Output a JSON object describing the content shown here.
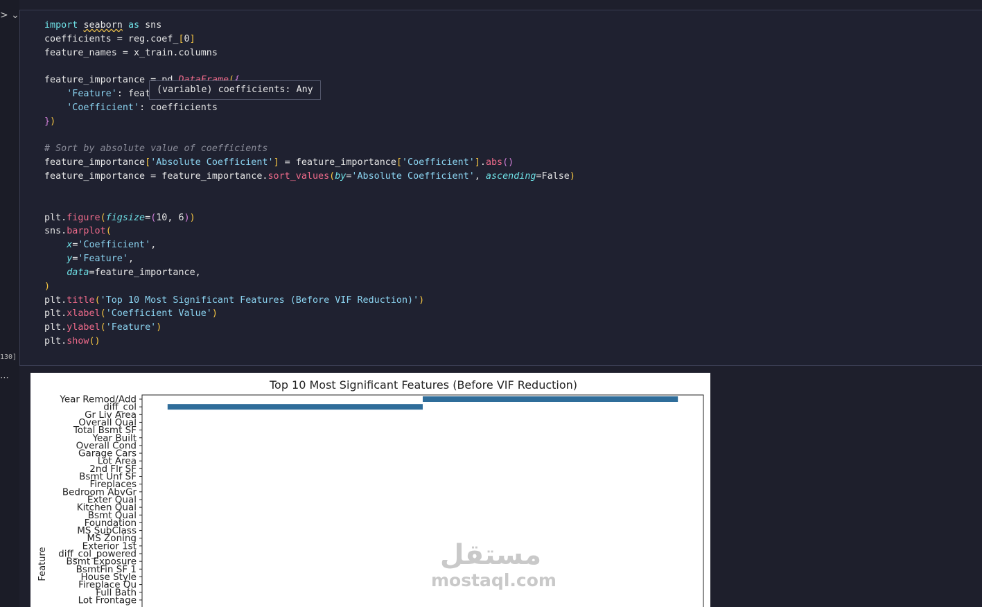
{
  "execution_count": "130]",
  "tooltip": "(variable) coefficients: Any",
  "code": {
    "import_kw": "import",
    "module": "seaborn",
    "as_kw": "as",
    "alias": "sns",
    "feature_label": "'Feature'",
    "feat_partial": "feat",
    "comment": "# Sort by absolute value of coefficients"
  },
  "output": {
    "title": "Top 10 Most Significant Features (Before VIF Reduction)",
    "ylabel": "Feature",
    "watermark_arabic": "مستقل",
    "watermark_latin": "mostaql.com"
  },
  "chart_data": {
    "type": "bar",
    "orientation": "horizontal",
    "title": "Top 10 Most Significant Features (Before VIF Reduction)",
    "ylabel": "Feature",
    "categories": [
      "Year Remod/Add",
      "diff_col",
      "Gr Liv Area",
      "Overall Qual",
      "Total Bsmt SF",
      "Year Built",
      "Overall Cond",
      "Garage Cars",
      "Lot Area",
      "2nd Flr SF",
      "Bsmt Unf SF",
      "Fireplaces",
      "Bedroom AbvGr",
      "Exter Qual",
      "Kitchen Qual",
      "Bsmt Qual",
      "Foundation",
      "MS SubClass",
      "MS Zoning",
      "Exterior 1st",
      "diff_col_powered",
      "Bsmt Exposure",
      "BsmtFin SF 1",
      "House Style",
      "Fireplace Qu",
      "Full Bath",
      "Lot Frontage"
    ],
    "values": [
      1.0,
      -1.0,
      0,
      0,
      0,
      0,
      0,
      0,
      0,
      0,
      0,
      0,
      0,
      0,
      0,
      0,
      0,
      0,
      0,
      0,
      0,
      0,
      0,
      0,
      0,
      0,
      0
    ],
    "xlim": [
      -1.1,
      1.1
    ],
    "color": "#2f6d9a",
    "grid": false
  }
}
